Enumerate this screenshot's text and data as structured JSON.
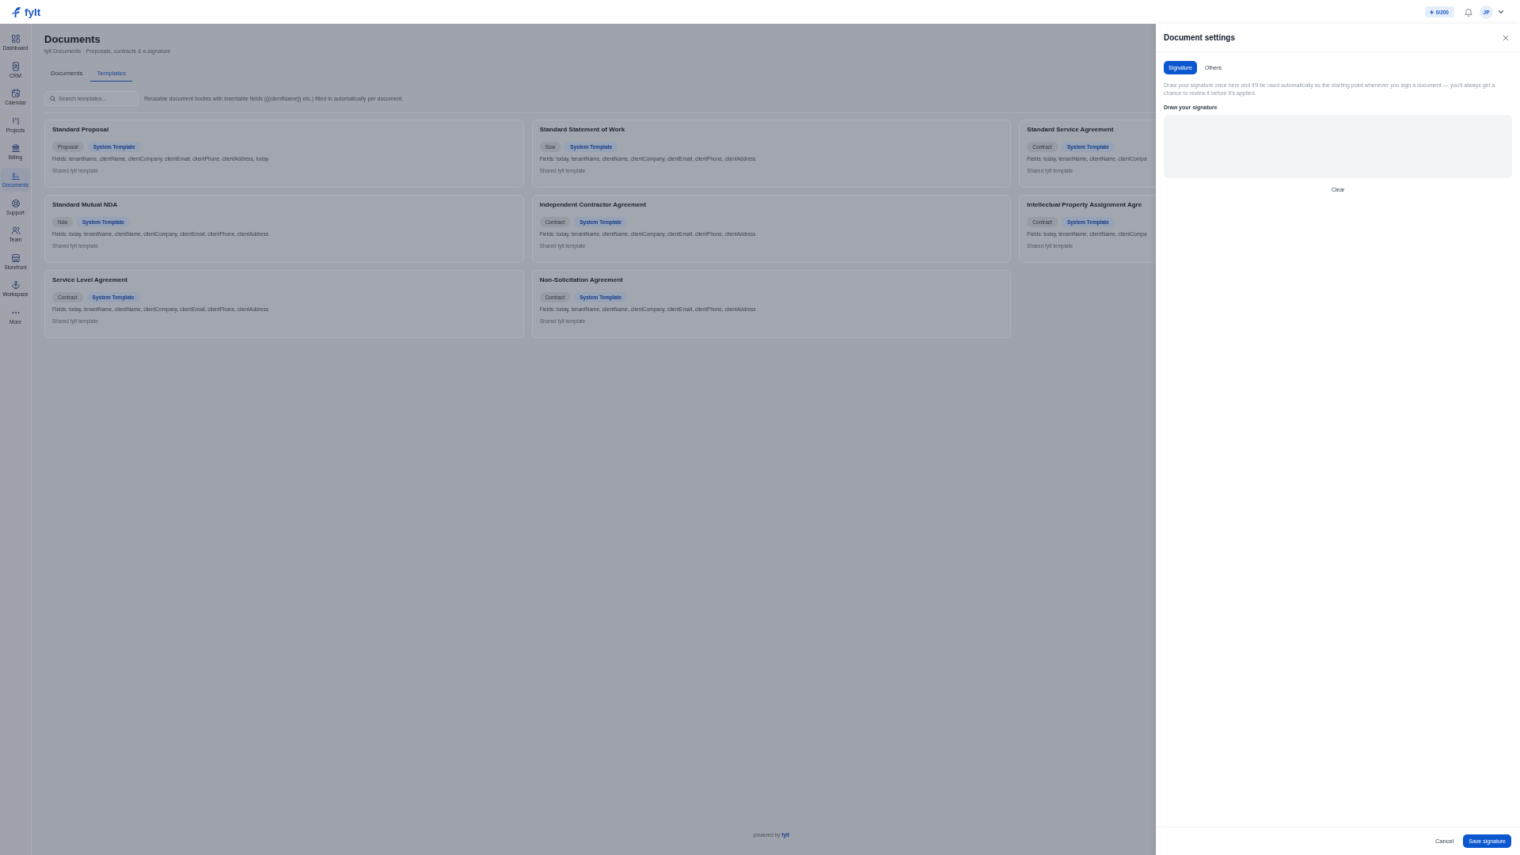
{
  "top_bar": {
    "logo": "fylt",
    "credits": "0/200",
    "avatar": "JP"
  },
  "sidebar": {
    "items": [
      {
        "label": "Dashboard",
        "selected": false
      },
      {
        "label": "CRM",
        "selected": false
      },
      {
        "label": "Calendar",
        "selected": false
      },
      {
        "label": "Projects",
        "selected": false
      },
      {
        "label": "Billing",
        "selected": false
      },
      {
        "label": "Documents",
        "selected": true
      },
      {
        "label": "Support",
        "selected": false
      },
      {
        "label": "Team",
        "selected": false
      },
      {
        "label": "Storefront",
        "selected": false
      },
      {
        "label": "Workspace",
        "selected": false
      },
      {
        "label": "More",
        "selected": false
      }
    ]
  },
  "page": {
    "title": "Documents",
    "subtitle": "fylt Documents · Proposals, contracts & e-signature",
    "tabs": [
      {
        "label": "Documents",
        "selected": false
      },
      {
        "label": "Templates",
        "selected": true
      }
    ],
    "search": {
      "placeholder": "Search templates..."
    },
    "description": "Reusable document bodies with insertable fields ({{clientName}} etc.) filled in automatically per document.",
    "templates": [
      {
        "title": "Standard Proposal",
        "category": "Proposal",
        "badge": "System Template",
        "fields": "Fields: tenantName, clientName, clientCompany, clientEmail, clientPhone, clientAddress, today",
        "note": "Shared fylt template"
      },
      {
        "title": "Standard Statement of Work",
        "category": "Sow",
        "badge": "System Template",
        "fields": "Fields: today, tenantName, clientName, clientCompany, clientEmail, clientPhone, clientAddress",
        "note": "Shared fylt template"
      },
      {
        "title": "Standard Service Agreement",
        "category": "Contract",
        "badge": "System Template",
        "fields": "Fields: today, tenantName, clientName, clientCompa",
        "note": "Shared fylt template"
      },
      {
        "title": "Standard Mutual NDA",
        "category": "Nda",
        "badge": "System Template",
        "fields": "Fields: today, tenantName, clientName, clientCompany, clientEmail, clientPhone, clientAddress",
        "note": "Shared fylt template"
      },
      {
        "title": "Independent Contractor Agreement",
        "category": "Contract",
        "badge": "System Template",
        "fields": "Fields: today, tenantName, clientName, clientCompany, clientEmail, clientPhone, clientAddress",
        "note": "Shared fylt template"
      },
      {
        "title": "Intellectual Property Assignment Agre",
        "category": "Contract",
        "badge": "System Template",
        "fields": "Fields: today, tenantName, clientName, clientCompa",
        "note": "Shared fylt template"
      },
      {
        "title": "Service Level Agreement",
        "category": "Contract",
        "badge": "System Template",
        "fields": "Fields: today, tenantName, clientName, clientCompany, clientEmail, clientPhone, clientAddress",
        "note": "Shared fylt template"
      },
      {
        "title": "Non-Solicitation Agreement",
        "category": "Contract",
        "badge": "System Template",
        "fields": "Fields: today, tenantName, clientName, clientCompany, clientEmail, clientPhone, clientAddress",
        "note": "Shared fylt template"
      }
    ],
    "footer": "powered by **fylt**"
  },
  "settings_panel": {
    "title": "Document settings",
    "tabs": [
      {
        "label": "Signature",
        "selected": true
      },
      {
        "label": "Others",
        "selected": false
      }
    ],
    "description": "Draw your signature once here and it'll be used automatically as the starting point whenever you sign a document — you'll always get a chance to review it before it's applied.",
    "signature_label": "Draw your signature",
    "clear": "Clear",
    "cancel": "Cancel",
    "save": "Save signature"
  }
}
